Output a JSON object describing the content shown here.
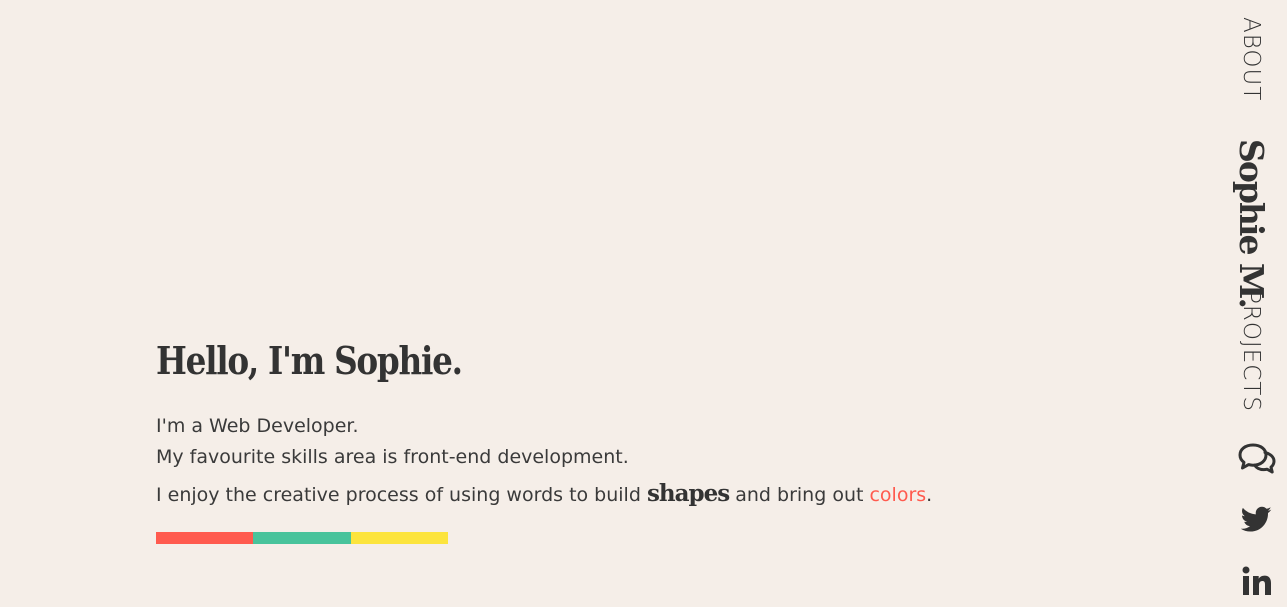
{
  "hero": {
    "title": "Hello, I'm Sophie.",
    "line1": "I'm a Web Developer.",
    "line2": "My favourite skills area is front-end development.",
    "line3_before": "I enjoy the creative process of using words to build ",
    "line3_shapes": "shapes",
    "line3_middle": " and bring out ",
    "line3_colors": "colors",
    "line3_end": "."
  },
  "color_bar": [
    "#ff5a4e",
    "#48c39b",
    "#fce43d"
  ],
  "side_nav": {
    "about_label": "ABOUT",
    "brand": "Sophie M.",
    "projects_label": "PROJECTS",
    "icons": [
      "chat-bubbles-icon",
      "twitter-icon",
      "linkedin-icon"
    ]
  },
  "colors": {
    "background": "#f5eee8",
    "text": "#333333",
    "accent": "#ff5a4e"
  }
}
